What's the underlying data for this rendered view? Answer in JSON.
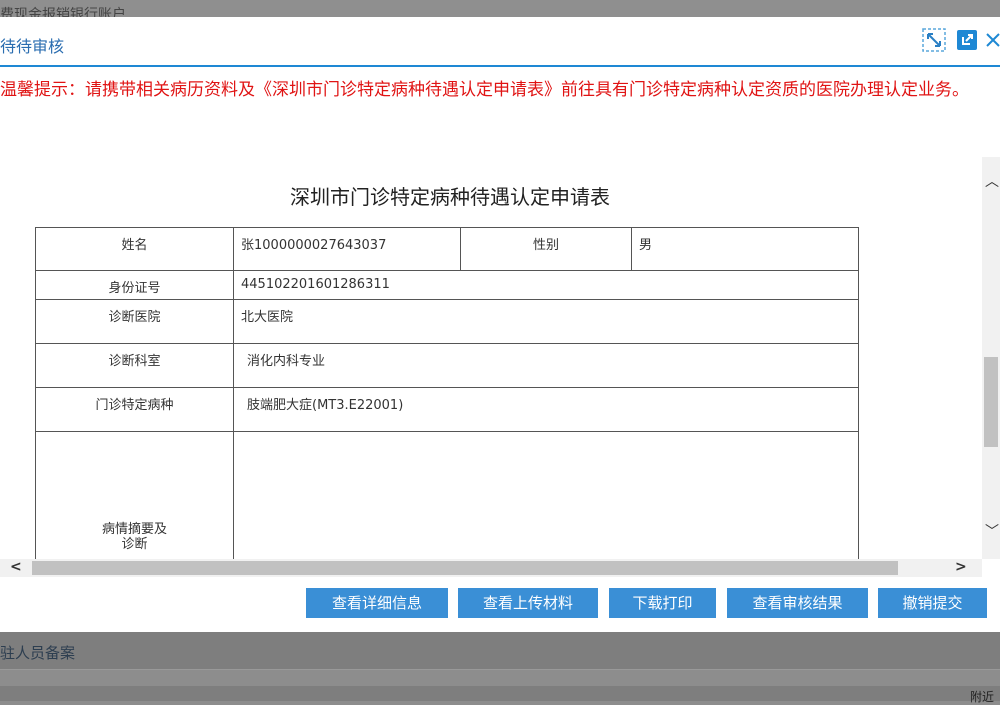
{
  "background": {
    "top_text": "费现金报销银行账户",
    "row1_text": "驻人员备案",
    "row2_text": "附近"
  },
  "dialog": {
    "title": "待待审核",
    "tip": "温馨提示：请携带相关病历资料及《深圳市门诊特定病种待遇认定申请表》前往具有门诊特定病种认定资质的医院办理认定业务。",
    "icons": [
      "maximize-icon",
      "open-external-icon",
      "close-icon"
    ]
  },
  "form": {
    "title": "深圳市门诊特定病种待遇认定申请表",
    "name_label": "姓名",
    "name_value": "张1000000027643037",
    "gender_label": "性别",
    "gender_value": "男",
    "id_label": "身份证号",
    "id_value": "445102201601286311",
    "hospital_label": "诊断医院",
    "hospital_value": "北大医院",
    "dept_label": "诊断科室",
    "dept_value": "消化内科专业",
    "disease_label": "门诊特定病种",
    "disease_value": "肢端肥大症(MT3.E22001)",
    "summary_label_1": "病情摘要及",
    "summary_label_2": "诊断"
  },
  "buttons": {
    "detail": "查看详细信息",
    "materials": "查看上传材料",
    "download": "下载打印",
    "result": "查看审核结果",
    "revoke": "撤销提交"
  },
  "colors": {
    "accent": "#1e88d4",
    "button": "#3a8fd6",
    "warning": "#e01414"
  }
}
